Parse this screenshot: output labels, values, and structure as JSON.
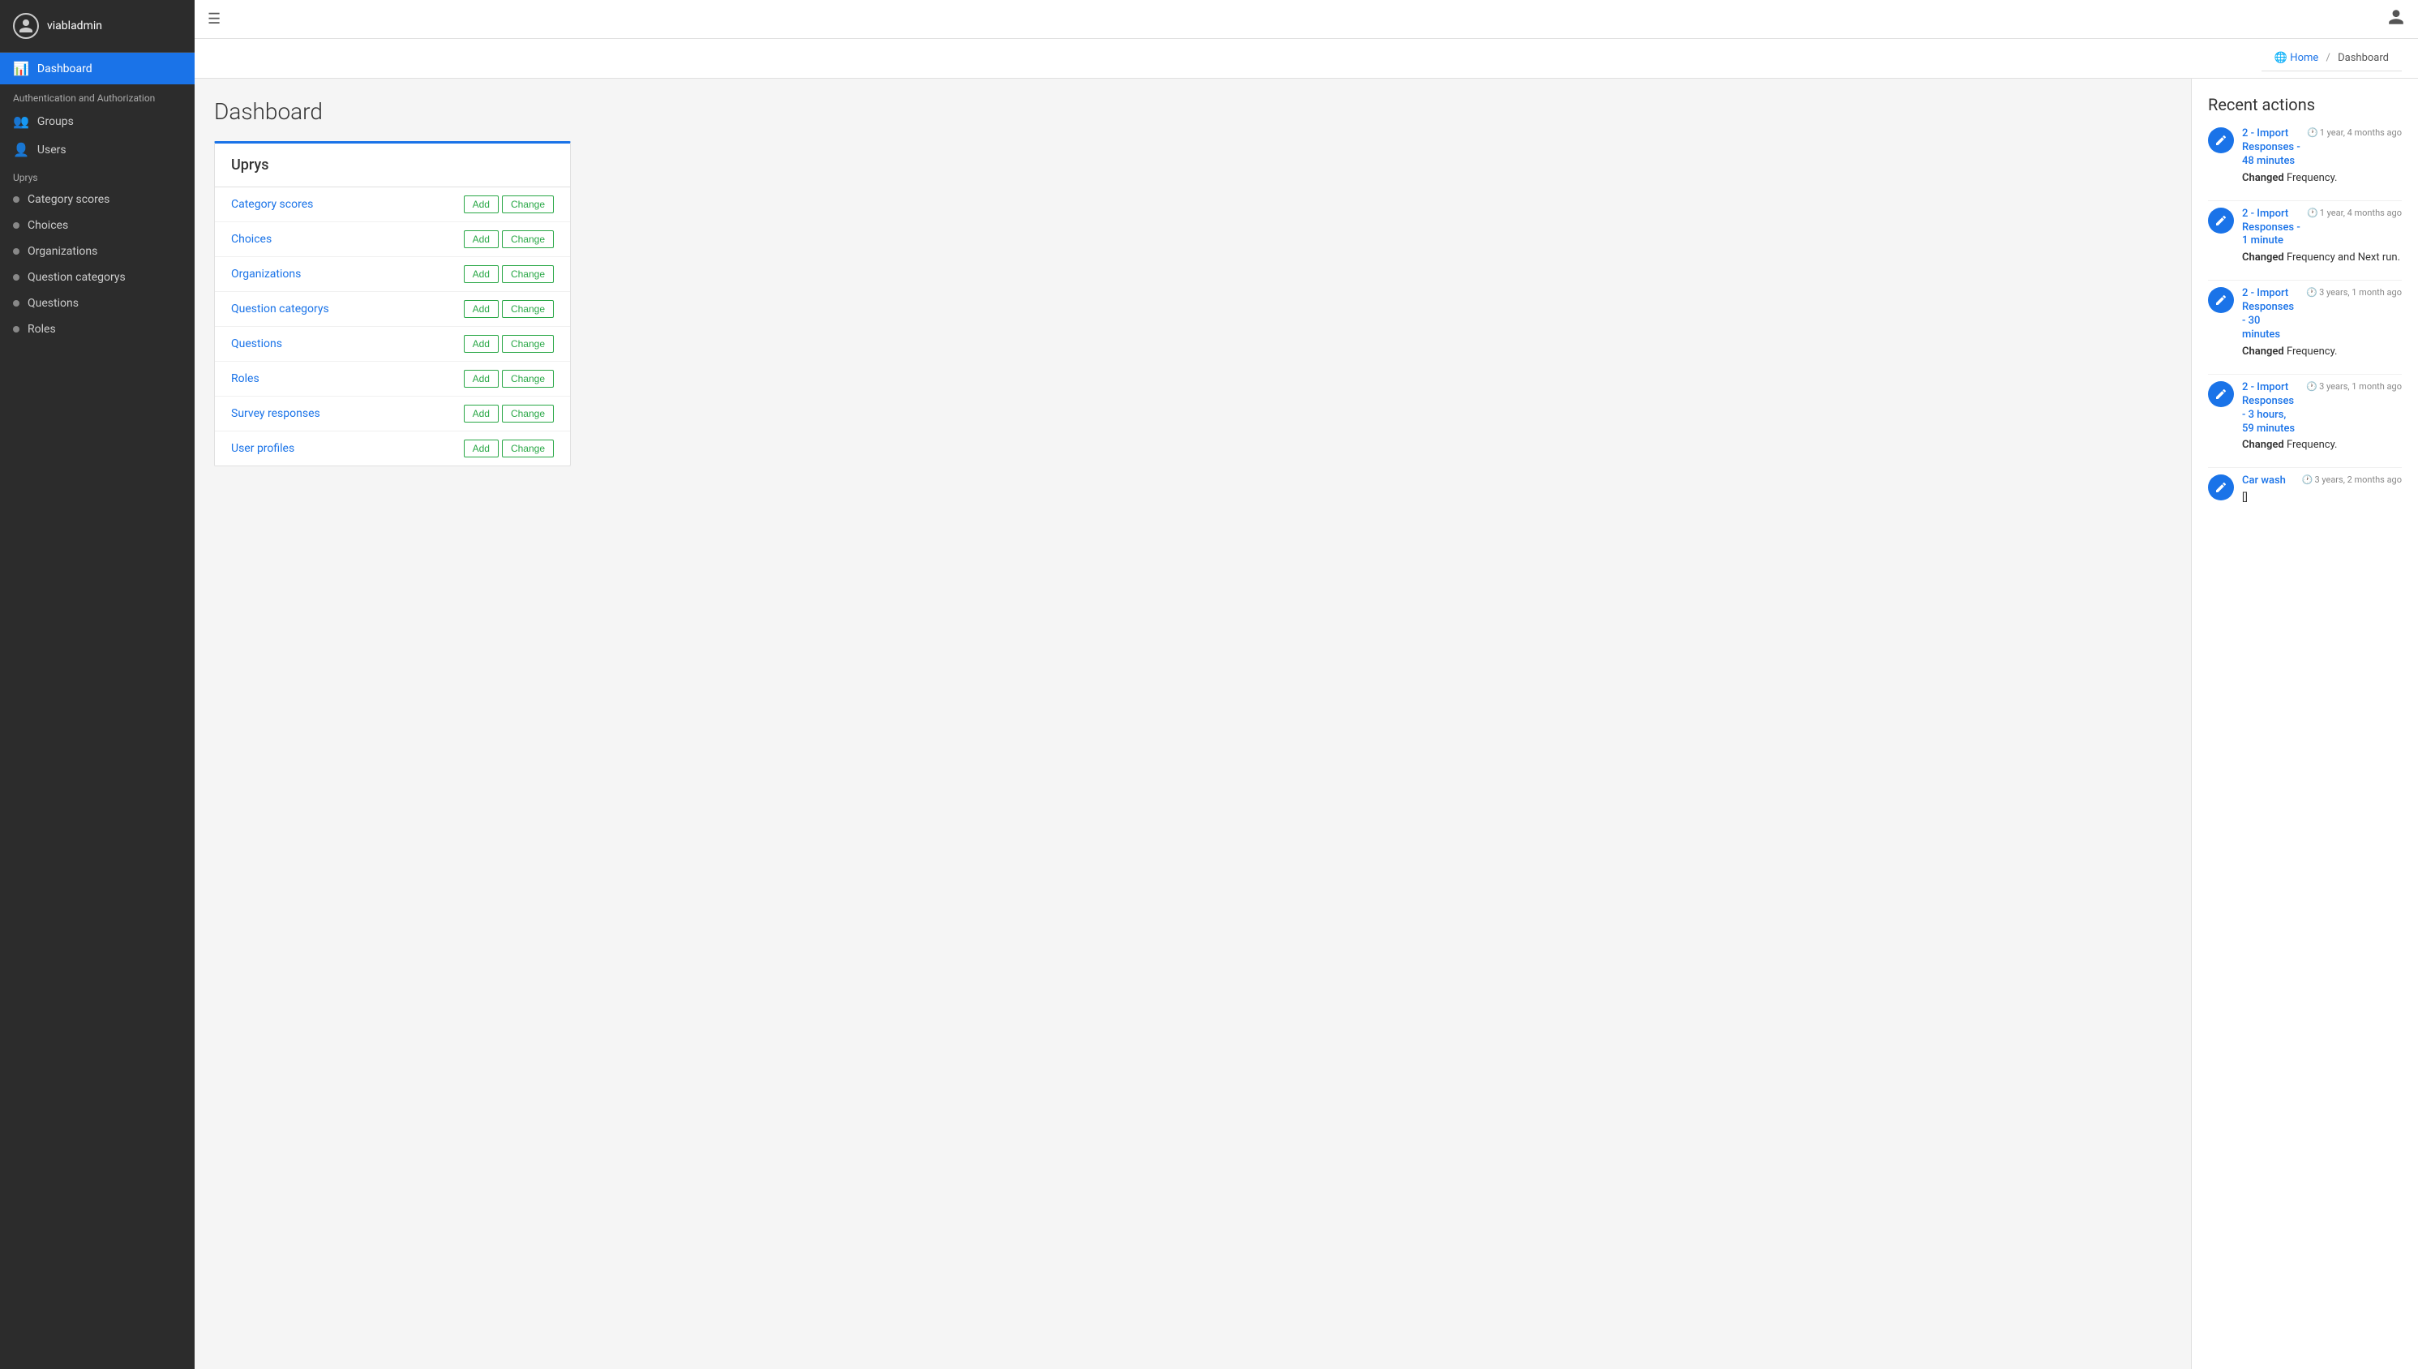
{
  "sidebar": {
    "username": "viabladmin",
    "nav_items": [
      {
        "id": "dashboard",
        "label": "Dashboard",
        "active": true
      },
      {
        "id": "auth-section",
        "label": "Authentication and Authorization",
        "type": "section"
      },
      {
        "id": "groups",
        "label": "Groups",
        "type": "item",
        "icon": "people"
      },
      {
        "id": "users",
        "label": "Users",
        "type": "item",
        "icon": "person"
      },
      {
        "id": "uprys-section",
        "label": "Uprys",
        "type": "section"
      },
      {
        "id": "category-scores",
        "label": "Category scores",
        "type": "dot-item"
      },
      {
        "id": "choices",
        "label": "Choices",
        "type": "dot-item"
      },
      {
        "id": "organizations",
        "label": "Organizations",
        "type": "dot-item"
      },
      {
        "id": "question-categorys",
        "label": "Question categorys",
        "type": "dot-item"
      },
      {
        "id": "questions",
        "label": "Questions",
        "type": "dot-item"
      },
      {
        "id": "roles",
        "label": "Roles",
        "type": "dot-item"
      }
    ]
  },
  "topbar": {
    "hamburger_icon": "☰",
    "user_icon": "👤"
  },
  "header": {
    "breadcrumb_home": "Home",
    "breadcrumb_sep": "/",
    "breadcrumb_current": "Dashboard"
  },
  "page": {
    "title": "Dashboard"
  },
  "uprys_card": {
    "heading": "Uprys",
    "rows": [
      {
        "label": "Category scores",
        "add": "Add",
        "change": "Change"
      },
      {
        "label": "Choices",
        "add": "Add",
        "change": "Change"
      },
      {
        "label": "Organizations",
        "add": "Add",
        "change": "Change"
      },
      {
        "label": "Question categorys",
        "add": "Add",
        "change": "Change"
      },
      {
        "label": "Questions",
        "add": "Add",
        "change": "Change"
      },
      {
        "label": "Roles",
        "add": "Add",
        "change": "Change"
      },
      {
        "label": "Survey responses",
        "add": "Add",
        "change": "Change"
      },
      {
        "label": "User profiles",
        "add": "Add",
        "change": "Change"
      }
    ]
  },
  "recent_actions": {
    "title": "Recent actions",
    "items": [
      {
        "id": 1,
        "link_text": "2 - Import Responses - 48 minutes",
        "time": "1 year, 4 months ago",
        "changed_label": "Changed",
        "description": "Frequency."
      },
      {
        "id": 2,
        "link_text": "2 - Import Responses - 1 minute",
        "time": "1 year, 4 months ago",
        "changed_label": "Changed",
        "description": "Frequency and Next run."
      },
      {
        "id": 3,
        "link_text": "2 - Import Responses - 30 minutes",
        "time": "3 years, 1 month ago",
        "changed_label": "Changed",
        "description": "Frequency."
      },
      {
        "id": 4,
        "link_text": "2 - Import Responses - 3 hours, 59 minutes",
        "time": "3 years, 1 month ago",
        "changed_label": "Changed",
        "description": "Frequency."
      },
      {
        "id": 5,
        "link_text": "Car wash",
        "time": "3 years, 2 months ago",
        "changed_label": "",
        "description": "[]"
      }
    ]
  },
  "colors": {
    "accent_blue": "#1a73e8",
    "sidebar_bg": "#2c2c2c",
    "green_btn": "#28a745"
  }
}
